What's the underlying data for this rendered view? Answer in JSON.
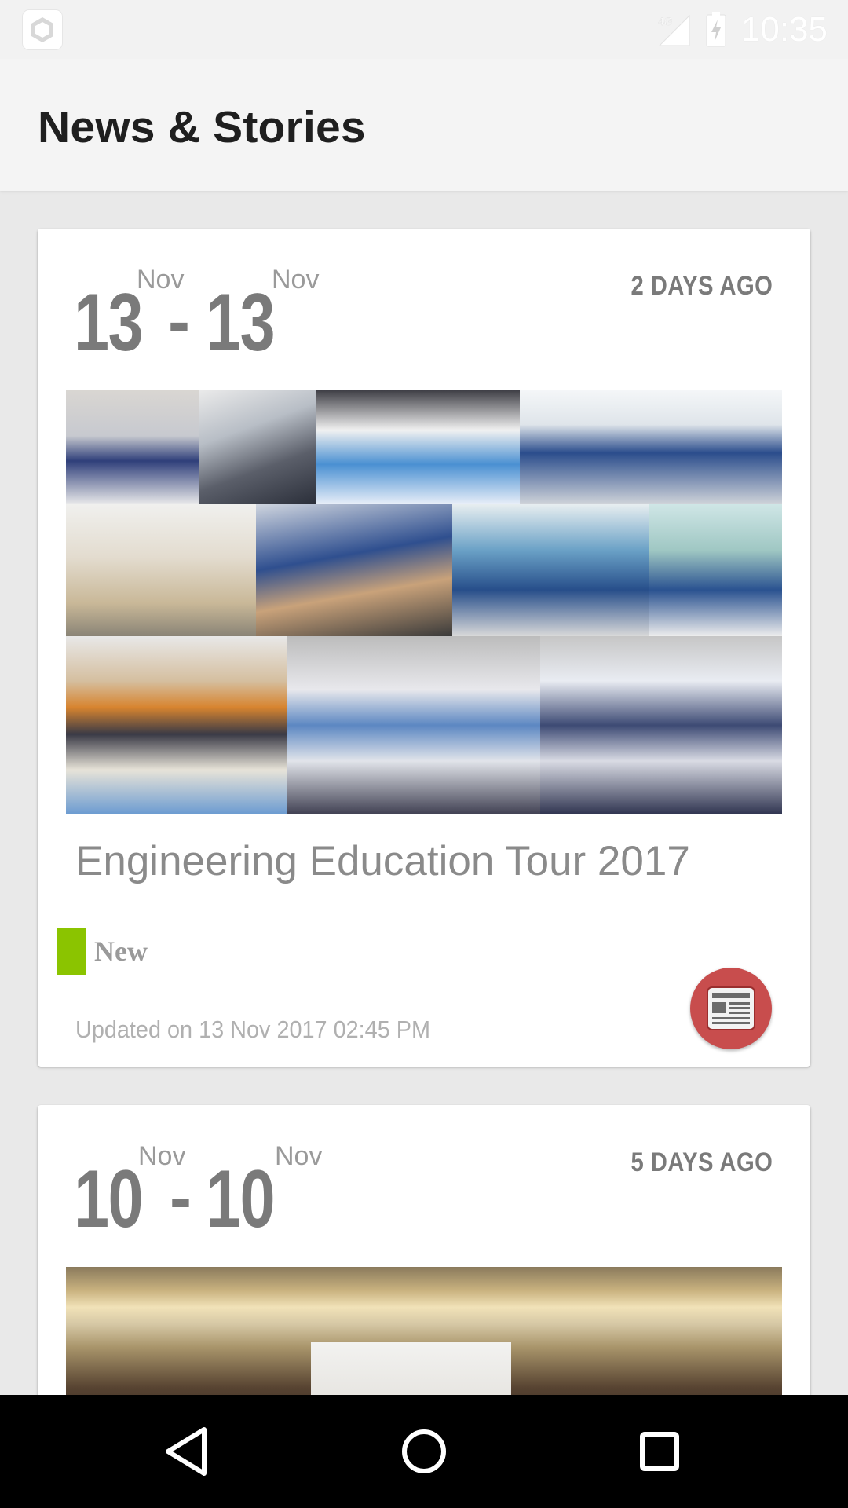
{
  "status_bar": {
    "time": "10:35",
    "network": "4G",
    "icons": [
      "app-icon",
      "signal-icon",
      "battery-charging-icon"
    ]
  },
  "app_bar": {
    "title": "News & Stories"
  },
  "cards": [
    {
      "start_day": "13",
      "start_month": "Nov",
      "end_day": "13",
      "end_month": "Nov",
      "separator": "-",
      "ago": "2 DAYS AGO",
      "title": "Engineering Education Tour 2017",
      "tag": "New",
      "tag_color": "#8bc400",
      "updated": "Updated on 13 Nov 2017 02:45 PM",
      "icon": "newspaper-icon"
    },
    {
      "start_day": "10",
      "start_month": "Nov",
      "end_day": "10",
      "end_month": "Nov",
      "separator": "-",
      "ago": "5 DAYS AGO"
    }
  ],
  "colors": {
    "tag_new": "#8bc400",
    "fab": "#c84d4d",
    "background": "#e9e9e9"
  },
  "nav_bar": {
    "icons": [
      "back-icon",
      "home-icon",
      "recent-apps-icon"
    ]
  }
}
